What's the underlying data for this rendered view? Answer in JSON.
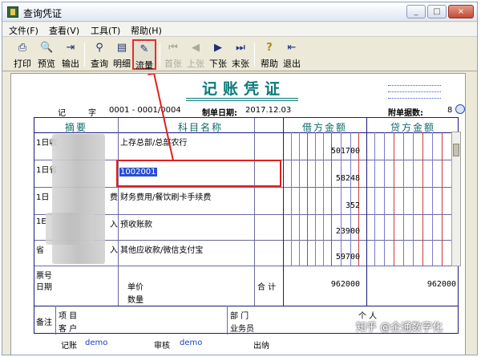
{
  "window": {
    "title": "查询凭证",
    "min": "_",
    "max": "□",
    "close": "×"
  },
  "menu": [
    "文件(F)",
    "查看(V)",
    "工具(T)",
    "帮助(H)"
  ],
  "toolbar": [
    {
      "label": "打印",
      "icon": "printer-icon",
      "glyph": "⎙"
    },
    {
      "label": "预览",
      "icon": "preview-icon",
      "glyph": "🔍"
    },
    {
      "label": "输出",
      "icon": "export-icon",
      "glyph": "⇥"
    },
    {
      "label": "查询",
      "icon": "binoculars-icon",
      "glyph": "⚲"
    },
    {
      "label": "明细",
      "icon": "detail-icon",
      "glyph": "▤"
    },
    {
      "label": "流量",
      "icon": "flow-icon",
      "glyph": "✎"
    },
    {
      "label": "首张",
      "icon": "first-icon",
      "glyph": "⏮"
    },
    {
      "label": "上张",
      "icon": "prev-icon",
      "glyph": "◀"
    },
    {
      "label": "下张",
      "icon": "next-icon",
      "glyph": "▶"
    },
    {
      "label": "末张",
      "icon": "last-icon",
      "glyph": "⏭"
    },
    {
      "label": "帮助",
      "icon": "help-icon",
      "glyph": "?"
    },
    {
      "label": "退出",
      "icon": "exit-icon",
      "glyph": "⇤"
    }
  ],
  "voucher": {
    "title": "记账凭证",
    "type_label": "记",
    "number_label": "字",
    "number": "0001 - 0001/0004",
    "date_label": "制单日期:",
    "date": "2017.12.03",
    "attach_label": "附单据数:",
    "attach_count": "8",
    "headers": {
      "summary": "摘要",
      "account": "科目名称",
      "debit": "借方金额",
      "credit": "贷方金额"
    },
    "rows": [
      {
        "summary": "1日收",
        "account": "上存总部/总部农行",
        "debit": "501700"
      },
      {
        "summary": "1日省",
        "account": "1002001",
        "debit": "58248"
      },
      {
        "summary": "1日",
        "account": "财务费用/餐饮刷卡手续费",
        "debit": "352"
      },
      {
        "summary": "1E",
        "account": "预收账款",
        "debit": "23900"
      },
      {
        "summary": "省",
        "account": "其他应收款/微信支付宝",
        "debit": "59700"
      }
    ],
    "row_suffix": [
      "",
      "",
      "费",
      "入",
      "入"
    ],
    "ticket_no": "票号",
    "date_field": "日期",
    "unit_price": "单价",
    "quantity": "数量",
    "total_label": "合 计",
    "total_debit": "962000",
    "total_credit": "962000",
    "note_label": "备注",
    "project_label": "项 目",
    "customer_label": "客 户",
    "dept_label": "部 门",
    "salesman_label": "业务员",
    "person_label": "个 人",
    "bookkeeper_label": "记账",
    "bookkeeper": "demo",
    "reviewer_label": "审核",
    "reviewer": "demo",
    "cashier_label": "出纳"
  },
  "watermark": "知乎 @企通数字化"
}
